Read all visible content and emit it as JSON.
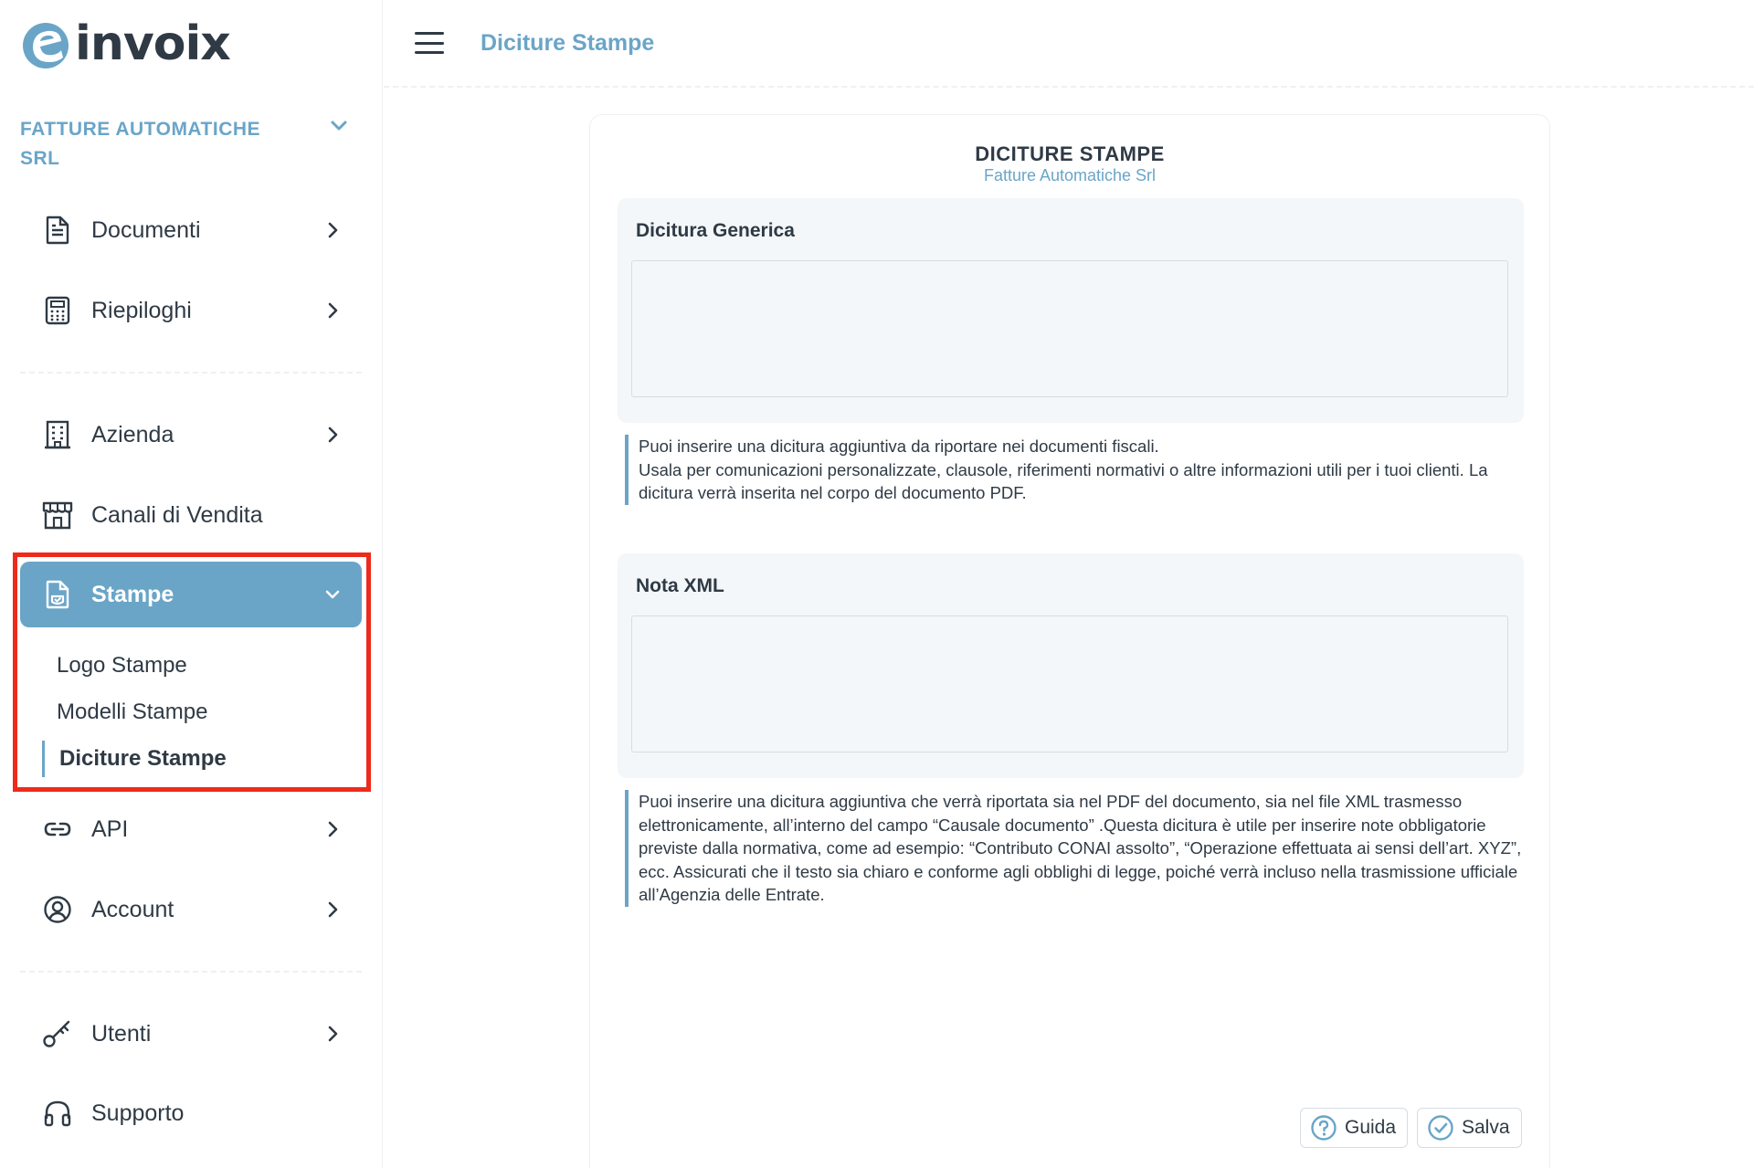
{
  "app": {
    "logo_text": "invoix",
    "brand_color": "#6aa5c8",
    "highlight_color": "#ee2a1b"
  },
  "sidebar": {
    "company": "FATTURE AUTOMATICHE SRL",
    "items": [
      {
        "label": "Documenti",
        "icon": "document-icon"
      },
      {
        "label": "Riepiloghi",
        "icon": "calculator-icon"
      },
      {
        "label": "Azienda",
        "icon": "building-icon"
      },
      {
        "label": "Canali di Vendita",
        "icon": "store-icon"
      },
      {
        "label": "Stampe",
        "icon": "print-file-icon"
      },
      {
        "label": "API",
        "icon": "link-icon"
      },
      {
        "label": "Account",
        "icon": "user-circle-icon"
      },
      {
        "label": "Utenti",
        "icon": "key-icon"
      },
      {
        "label": "Supporto",
        "icon": "headphones-icon"
      }
    ],
    "stampe_sub": [
      "Logo Stampe",
      "Modelli Stampe",
      "Diciture Stampe"
    ]
  },
  "topbar": {
    "crumb": "Diciture Stampe"
  },
  "card": {
    "title": "DICITURE STAMPE",
    "subtitle": "Fatture Automatiche Srl",
    "sections": [
      {
        "label": "Dicitura Generica",
        "value": "",
        "help": "Puoi inserire una dicitura aggiuntiva da riportare nei documenti fiscali.\nUsala per comunicazioni personalizzate, clausole, riferimenti normativi o altre informazioni utili per i tuoi clienti. La dicitura verrà inserita nel corpo del documento PDF."
      },
      {
        "label": "Nota XML",
        "value": "",
        "help": "Puoi inserire una dicitura aggiuntiva che verrà riportata sia nel PDF del documento, sia nel file XML trasmesso elettronicamente, all’interno del campo “Causale documento” .Questa dicitura è utile per inserire note obbligatorie previste dalla normativa, come ad esempio: “Contributo CONAI assolto”, “Operazione effettuata ai sensi dell’art. XYZ”, ecc. Assicurati che il testo sia chiaro e conforme agli obblighi di legge, poiché verrà incluso nella trasmissione ufficiale all’Agenzia delle Entrate."
      }
    ],
    "buttons": {
      "help": "Guida",
      "save": "Salva"
    }
  }
}
